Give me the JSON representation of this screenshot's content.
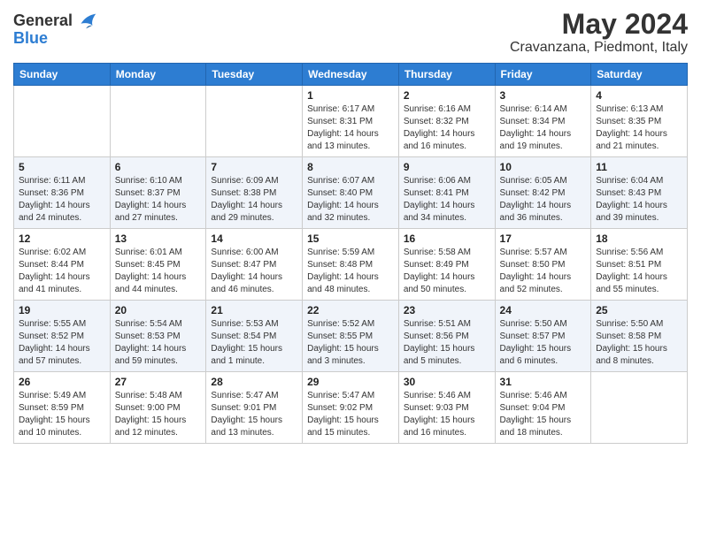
{
  "header": {
    "logo_line1": "General",
    "logo_line2": "Blue",
    "title": "May 2024",
    "subtitle": "Cravanzana, Piedmont, Italy"
  },
  "weekdays": [
    "Sunday",
    "Monday",
    "Tuesday",
    "Wednesday",
    "Thursday",
    "Friday",
    "Saturday"
  ],
  "weeks": [
    [
      {
        "day": "",
        "info": ""
      },
      {
        "day": "",
        "info": ""
      },
      {
        "day": "",
        "info": ""
      },
      {
        "day": "1",
        "info": "Sunrise: 6:17 AM\nSunset: 8:31 PM\nDaylight: 14 hours\nand 13 minutes."
      },
      {
        "day": "2",
        "info": "Sunrise: 6:16 AM\nSunset: 8:32 PM\nDaylight: 14 hours\nand 16 minutes."
      },
      {
        "day": "3",
        "info": "Sunrise: 6:14 AM\nSunset: 8:34 PM\nDaylight: 14 hours\nand 19 minutes."
      },
      {
        "day": "4",
        "info": "Sunrise: 6:13 AM\nSunset: 8:35 PM\nDaylight: 14 hours\nand 21 minutes."
      }
    ],
    [
      {
        "day": "5",
        "info": "Sunrise: 6:11 AM\nSunset: 8:36 PM\nDaylight: 14 hours\nand 24 minutes."
      },
      {
        "day": "6",
        "info": "Sunrise: 6:10 AM\nSunset: 8:37 PM\nDaylight: 14 hours\nand 27 minutes."
      },
      {
        "day": "7",
        "info": "Sunrise: 6:09 AM\nSunset: 8:38 PM\nDaylight: 14 hours\nand 29 minutes."
      },
      {
        "day": "8",
        "info": "Sunrise: 6:07 AM\nSunset: 8:40 PM\nDaylight: 14 hours\nand 32 minutes."
      },
      {
        "day": "9",
        "info": "Sunrise: 6:06 AM\nSunset: 8:41 PM\nDaylight: 14 hours\nand 34 minutes."
      },
      {
        "day": "10",
        "info": "Sunrise: 6:05 AM\nSunset: 8:42 PM\nDaylight: 14 hours\nand 36 minutes."
      },
      {
        "day": "11",
        "info": "Sunrise: 6:04 AM\nSunset: 8:43 PM\nDaylight: 14 hours\nand 39 minutes."
      }
    ],
    [
      {
        "day": "12",
        "info": "Sunrise: 6:02 AM\nSunset: 8:44 PM\nDaylight: 14 hours\nand 41 minutes."
      },
      {
        "day": "13",
        "info": "Sunrise: 6:01 AM\nSunset: 8:45 PM\nDaylight: 14 hours\nand 44 minutes."
      },
      {
        "day": "14",
        "info": "Sunrise: 6:00 AM\nSunset: 8:47 PM\nDaylight: 14 hours\nand 46 minutes."
      },
      {
        "day": "15",
        "info": "Sunrise: 5:59 AM\nSunset: 8:48 PM\nDaylight: 14 hours\nand 48 minutes."
      },
      {
        "day": "16",
        "info": "Sunrise: 5:58 AM\nSunset: 8:49 PM\nDaylight: 14 hours\nand 50 minutes."
      },
      {
        "day": "17",
        "info": "Sunrise: 5:57 AM\nSunset: 8:50 PM\nDaylight: 14 hours\nand 52 minutes."
      },
      {
        "day": "18",
        "info": "Sunrise: 5:56 AM\nSunset: 8:51 PM\nDaylight: 14 hours\nand 55 minutes."
      }
    ],
    [
      {
        "day": "19",
        "info": "Sunrise: 5:55 AM\nSunset: 8:52 PM\nDaylight: 14 hours\nand 57 minutes."
      },
      {
        "day": "20",
        "info": "Sunrise: 5:54 AM\nSunset: 8:53 PM\nDaylight: 14 hours\nand 59 minutes."
      },
      {
        "day": "21",
        "info": "Sunrise: 5:53 AM\nSunset: 8:54 PM\nDaylight: 15 hours\nand 1 minute."
      },
      {
        "day": "22",
        "info": "Sunrise: 5:52 AM\nSunset: 8:55 PM\nDaylight: 15 hours\nand 3 minutes."
      },
      {
        "day": "23",
        "info": "Sunrise: 5:51 AM\nSunset: 8:56 PM\nDaylight: 15 hours\nand 5 minutes."
      },
      {
        "day": "24",
        "info": "Sunrise: 5:50 AM\nSunset: 8:57 PM\nDaylight: 15 hours\nand 6 minutes."
      },
      {
        "day": "25",
        "info": "Sunrise: 5:50 AM\nSunset: 8:58 PM\nDaylight: 15 hours\nand 8 minutes."
      }
    ],
    [
      {
        "day": "26",
        "info": "Sunrise: 5:49 AM\nSunset: 8:59 PM\nDaylight: 15 hours\nand 10 minutes."
      },
      {
        "day": "27",
        "info": "Sunrise: 5:48 AM\nSunset: 9:00 PM\nDaylight: 15 hours\nand 12 minutes."
      },
      {
        "day": "28",
        "info": "Sunrise: 5:47 AM\nSunset: 9:01 PM\nDaylight: 15 hours\nand 13 minutes."
      },
      {
        "day": "29",
        "info": "Sunrise: 5:47 AM\nSunset: 9:02 PM\nDaylight: 15 hours\nand 15 minutes."
      },
      {
        "day": "30",
        "info": "Sunrise: 5:46 AM\nSunset: 9:03 PM\nDaylight: 15 hours\nand 16 minutes."
      },
      {
        "day": "31",
        "info": "Sunrise: 5:46 AM\nSunset: 9:04 PM\nDaylight: 15 hours\nand 18 minutes."
      },
      {
        "day": "",
        "info": ""
      }
    ]
  ]
}
